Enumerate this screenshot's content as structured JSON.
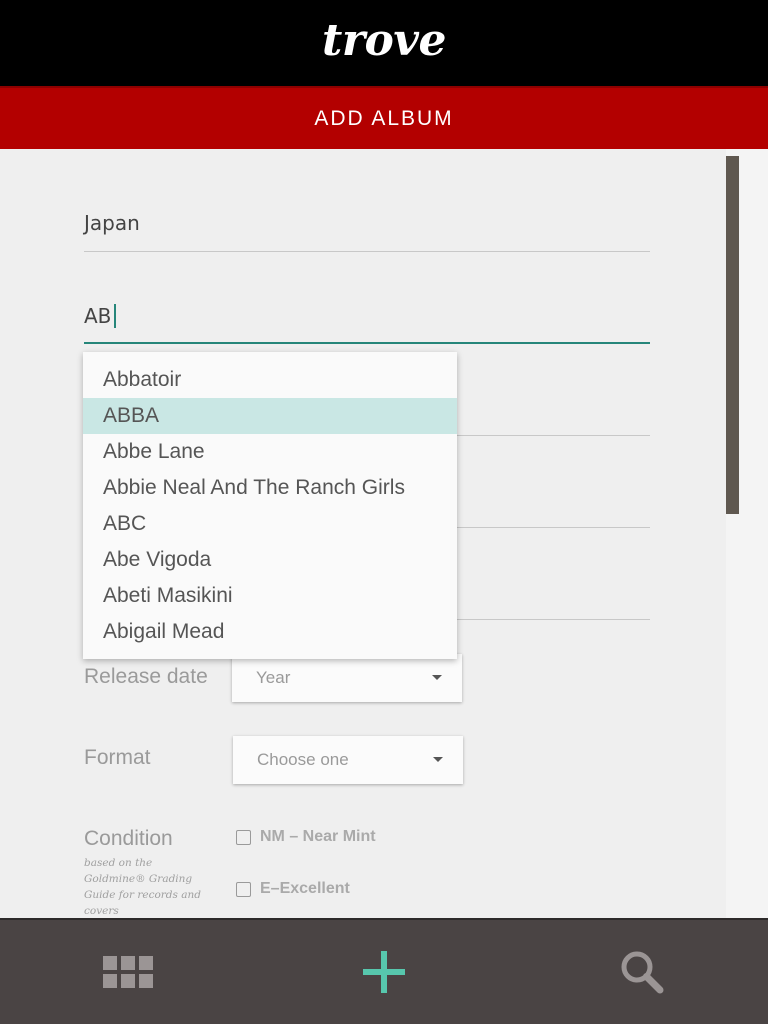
{
  "app": {
    "logo": "trove",
    "screen_title": "ADD ALBUM"
  },
  "form": {
    "country": {
      "value": "Japan"
    },
    "artist": {
      "value": "AB"
    },
    "artist_suggestions": [
      "Abbatoir",
      "ABBA",
      "Abbe Lane",
      "Abbie Neal And The Ranch Girls",
      "ABC",
      "Abe Vigoda",
      "Abeti Masikini",
      "Abigail Mead"
    ],
    "selected_suggestion": "ABBA",
    "release_date": {
      "label": "Release date",
      "placeholder": "Year"
    },
    "format": {
      "label": "Format",
      "placeholder": "Choose one"
    },
    "condition": {
      "label": "Condition",
      "note": "based on the Goldmine® Grading Guide for records and covers",
      "options": [
        "NM – Near Mint",
        "E–Excellent"
      ]
    }
  },
  "bottom_nav": {
    "items": [
      {
        "name": "collection",
        "icon": "grid-icon"
      },
      {
        "name": "add",
        "icon": "plus-icon"
      },
      {
        "name": "search",
        "icon": "search-icon"
      }
    ]
  },
  "colors": {
    "header_bg": "#000000",
    "title_bar_bg": "#b30000",
    "accent": "#26867a",
    "selected_item_bg": "#c9e7e4",
    "bottom_bar_bg": "#4a4444",
    "add_icon": "#57c7ad"
  }
}
